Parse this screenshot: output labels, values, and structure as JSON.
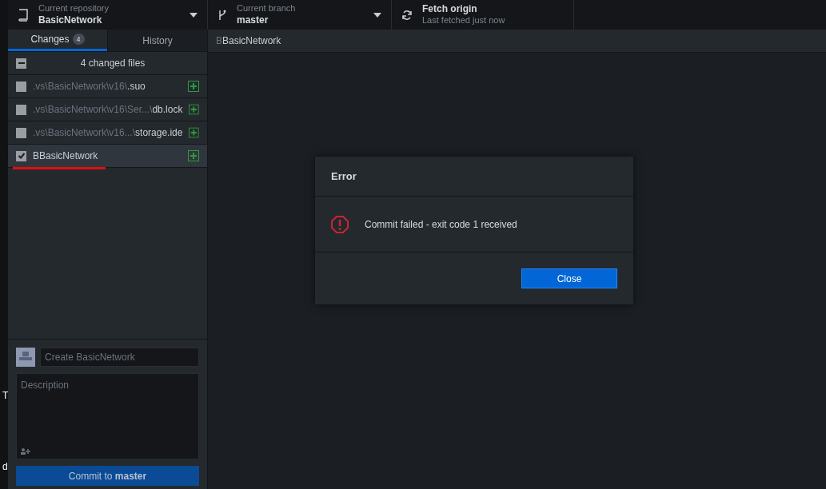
{
  "edge_texts": [
    "T",
    "d"
  ],
  "toolbar": {
    "repository": {
      "label": "Current repository",
      "value": "BasicNetwork"
    },
    "branch": {
      "label": "Current branch",
      "value": "master"
    },
    "fetch": {
      "label": "Fetch origin",
      "sub": "Last fetched just now"
    }
  },
  "tabs": [
    {
      "label": "Changes",
      "count": "4",
      "selected": true
    },
    {
      "label": "History",
      "selected": false
    }
  ],
  "changes": {
    "header": "4 changed files",
    "header_checkbox": {
      "indeterminate": true
    },
    "files": [
      {
        "dir": ".vs\\BasicNetwork\\v16\\",
        "name": ".suo",
        "checked": false,
        "selected": false
      },
      {
        "dir": ".vs\\BasicNetwork\\v16\\Ser...\\",
        "name": "db.lock",
        "checked": false,
        "selected": false
      },
      {
        "dir": ".vs\\BasicNetwork\\v16...\\",
        "name": "storage.ide",
        "checked": false,
        "selected": false
      },
      {
        "name": "BBasicNetwork",
        "checked": true,
        "selected": true
      }
    ]
  },
  "commit": {
    "summary_placeholder": "Create BasicNetwork",
    "description_placeholder": "Description",
    "button": {
      "prefix": "Commit to ",
      "branch": "master"
    }
  },
  "main_header": {
    "dir": "B",
    "name": "BasicNetwork"
  },
  "dialog": {
    "title": "Error",
    "message": "Commit failed - exit code 1 received",
    "button": "Close"
  }
}
